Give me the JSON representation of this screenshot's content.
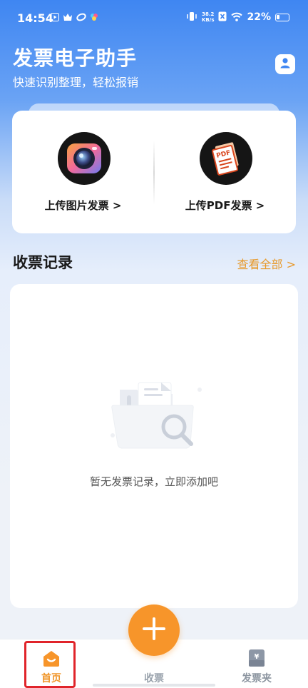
{
  "status_bar": {
    "time": "14:54",
    "net_speed_value": "38.2",
    "net_speed_unit": "KB/s",
    "battery_percent": "22%",
    "icons": [
      "video-icon",
      "crown-icon",
      "link-icon",
      "app-icon",
      "vibrate-icon",
      "sim-icon",
      "wifi-icon",
      "battery-icon"
    ]
  },
  "header": {
    "title": "发票电子助手",
    "subtitle": "快速识别整理，轻松报销",
    "profile_icon": "user-icon"
  },
  "upload": {
    "image_label": "上传图片发票 >",
    "image_icon": "camera-icon",
    "pdf_label": "上传PDF发票 >",
    "pdf_icon": "pdf-document-icon"
  },
  "records": {
    "title": "收票记录",
    "view_all": "查看全部 >",
    "empty_text": "暂无发票记录，立即添加吧",
    "empty_icon": "empty-folder-search-icon"
  },
  "bottom_nav": {
    "home_label": "首页",
    "collect_label": "收票",
    "folder_label": "发票夹",
    "add_icon": "plus-icon"
  },
  "colors": {
    "accent": "#f7952a",
    "link": "#e79a2c",
    "header_blue": "#3f86f2",
    "highlight": "#e0242a"
  }
}
